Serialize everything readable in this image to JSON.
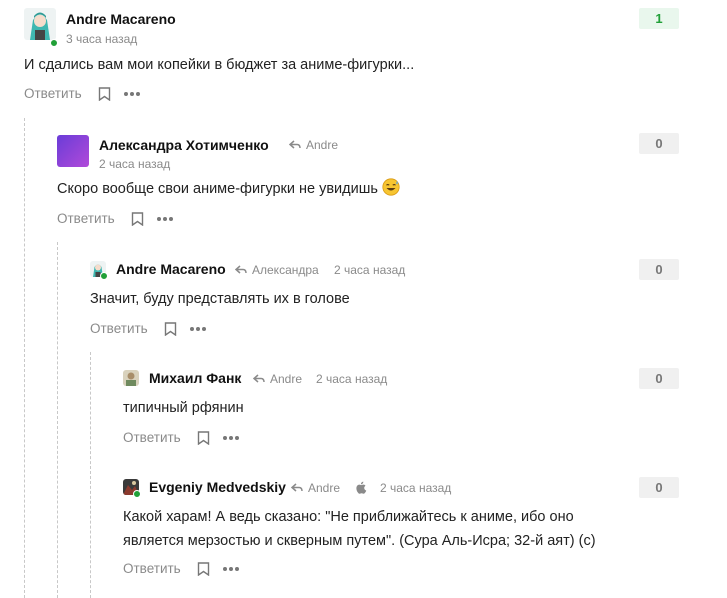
{
  "comments": [
    {
      "author": "Andre Macareno",
      "time": "3 часа назад",
      "rating": "1",
      "text": "И сдались вам мои копейки в бюджет за аниме-фигурки...",
      "reply_label": "Ответить",
      "online": true
    },
    {
      "author": "Александра Хотимченко",
      "reply_to": "Andre",
      "time": "2 часа назад",
      "rating": "0",
      "text": "Скоро вообще свои аниме-фигурки не увидишь",
      "emoji": "sweat-smile-emoji",
      "reply_label": "Ответить"
    },
    {
      "author": "Andre Macareno",
      "reply_to": "Александра",
      "time": "2 часа назад",
      "rating": "0",
      "text": "Значит, буду представлять их в голове",
      "reply_label": "Ответить",
      "online": true
    },
    {
      "author": "Михаил Фанк",
      "reply_to": "Andre",
      "time": "2 часа назад",
      "rating": "0",
      "text": "типичный рфянин",
      "reply_label": "Ответить"
    },
    {
      "author": "Evgeniy Medvedskiy",
      "reply_to": "Andre",
      "platform_icon": "apple-icon",
      "time": "2 часа назад",
      "rating": "0",
      "text_line1": "Какой харам! А ведь сказано: \"Не приближайтесь к аниме, ибо оно",
      "text_line2": "является мерзостью и скверным путем\". (Сура Аль-Исра; 32-й аят) (с)",
      "reply_label": "Ответить",
      "online": true
    }
  ],
  "colors": {
    "accent_green": "#21a038",
    "muted_text": "#8a8a8a",
    "rating_zero_bg": "#f0f0f0",
    "rating_positive_bg": "#e9f7ed"
  }
}
